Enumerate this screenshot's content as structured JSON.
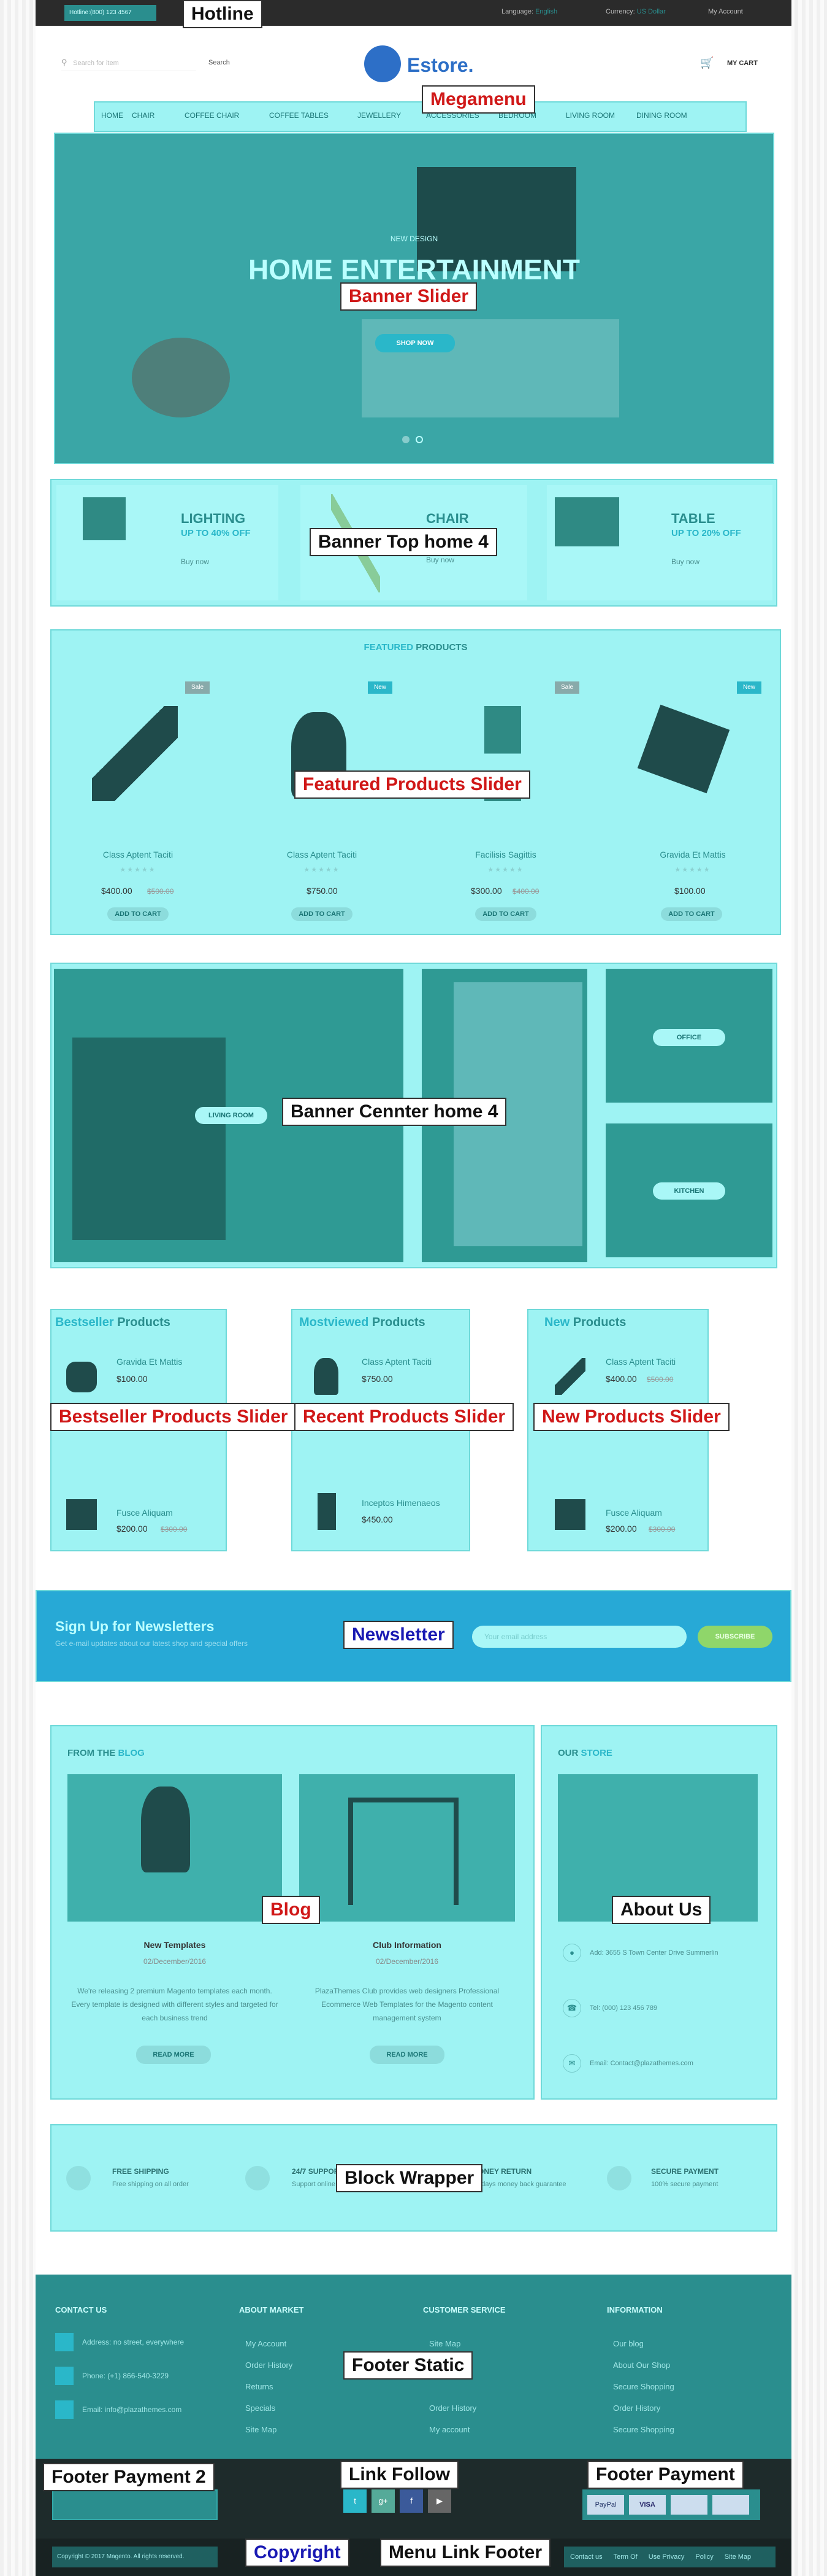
{
  "topbar": {
    "hotline": "Hotline:(800) 123 4567",
    "language_label": "Language:",
    "language": "English",
    "currency_label": "Currency:",
    "currency": "US Dollar",
    "account": "My Account"
  },
  "header": {
    "search_placeholder": "Search for item",
    "search_btn": "Search",
    "logo": "Estore.",
    "cart": "MY CART"
  },
  "menu": [
    "HOME",
    "CHAIR",
    "COFFEE CHAIR",
    "COFFEE TABLES",
    "JEWELLERY",
    "ACCESSORIES",
    "BEDROOM",
    "LIVING ROOM",
    "DINING ROOM"
  ],
  "banner": {
    "small": "NEW DESIGN",
    "title": "HOME ENTERTAINMENT",
    "btn": "SHOP NOW"
  },
  "promo": [
    {
      "title": "LIGHTING",
      "sub": "UP TO 40% OFF",
      "link": "Buy now"
    },
    {
      "title": "CHAIR",
      "sub": "",
      "link": "Buy now"
    },
    {
      "title": "TABLE",
      "sub": "UP TO 20% OFF",
      "link": "Buy now"
    }
  ],
  "featured": {
    "title_a": "FEATURED",
    "title_b": "PRODUCTS",
    "items": [
      {
        "badge": "Sale",
        "name": "Class Aptent Taciti",
        "price": "$400.00",
        "old": "$500.00"
      },
      {
        "badge": "New",
        "name": "Class Aptent Taciti",
        "price": "$750.00",
        "old": ""
      },
      {
        "badge": "Sale",
        "name": "Facilisis Sagittis",
        "price": "$300.00",
        "old": "$400.00"
      },
      {
        "badge": "New",
        "name": "Gravida Et Mattis",
        "price": "$100.00",
        "old": ""
      }
    ],
    "add": "ADD TO CART"
  },
  "center": {
    "living": "LIVING ROOM",
    "office": "OFFICE",
    "kitchen": "KITCHEN"
  },
  "lists": [
    {
      "a": "Bestseller",
      "b": "Products",
      "items": [
        {
          "name": "Gravida Et Mattis",
          "price": "$100.00",
          "old": ""
        },
        {
          "name": "Fusce Aliquam",
          "price": "$200.00",
          "old": "$300.00"
        }
      ]
    },
    {
      "a": "Mostviewed",
      "b": "Products",
      "items": [
        {
          "name": "Class Aptent Taciti",
          "price": "$750.00",
          "old": ""
        },
        {
          "name": "Inceptos Himenaeos",
          "price": "$450.00",
          "old": ""
        }
      ]
    },
    {
      "a": "New",
      "b": "Products",
      "items": [
        {
          "name": "Class Aptent Taciti",
          "price": "$400.00",
          "old": "$500.00"
        },
        {
          "name": "Fusce Aliquam",
          "price": "$200.00",
          "old": "$300.00"
        }
      ]
    }
  ],
  "newsletter": {
    "title": "Sign Up for Newsletters",
    "sub": "Get e-mail updates about our latest shop and special offers",
    "placeholder": "Your email address",
    "btn": "SUBSCRIBE"
  },
  "blog": {
    "title_a": "FROM THE",
    "title_b": "BLOG",
    "posts": [
      {
        "title": "New Templates",
        "date": "02/December/2016",
        "text": "We're releasing 2 premium Magento templates each month. Every template is designed with different styles and targeted for each business trend",
        "more": "READ MORE"
      },
      {
        "title": "Club Information",
        "date": "02/December/2016",
        "text": "PlazaThemes Club provides web designers Professional Ecommerce Web Templates for the Magento content management system",
        "more": "READ MORE"
      }
    ]
  },
  "store": {
    "title_a": "OUR",
    "title_b": "STORE",
    "address": "Add: 3655 S Town Center Drive Summerlin",
    "tel": "Tel: (000) 123 456 789",
    "email": "Email: Contact@plazathemes.com"
  },
  "services": [
    {
      "t": "FREE SHIPPING",
      "s": "Free shipping on all order"
    },
    {
      "t": "24/7 SUPPORT",
      "s": "Support online 24 hours"
    },
    {
      "t": "MONEY RETURN",
      "s": "30 days money back guarantee"
    },
    {
      "t": "SECURE PAYMENT",
      "s": "100% secure payment"
    }
  ],
  "footer": {
    "cols": [
      {
        "title": "CONTACT US",
        "lines": [
          "Address: no street, everywhere",
          "Phone: (+1) 866-540-3229",
          "Email: info@plazathemes.com"
        ]
      },
      {
        "title": "ABOUT MARKET",
        "lines": [
          "My Account",
          "Order History",
          "Returns",
          "Specials",
          "Site Map"
        ]
      },
      {
        "title": "CUSTOMER SERVICE",
        "lines": [
          "Site Map",
          "Order History",
          "My account"
        ]
      },
      {
        "title": "INFORMATION",
        "lines": [
          "Our blog",
          "About Our Shop",
          "Secure Shopping",
          "Order History",
          "Secure Shopping"
        ]
      }
    ],
    "copyright": "Copyright © 2017 Magento. All rights reserved.",
    "menu": [
      "Contact us",
      "Term Of",
      "Use Privacy",
      "Policy",
      "Site Map"
    ],
    "payments": [
      "PayPal",
      "VISA",
      "",
      ""
    ]
  },
  "callouts": {
    "hotline": "Hotline",
    "megamenu": "Megamenu",
    "banner": "Banner Slider",
    "top4": "Banner Top home 4",
    "featured": "Featured Products Slider",
    "center": "Banner Cennter home 4",
    "best": "Bestseller Products Slider",
    "recent": "Recent Products Slider",
    "new": "New Products Slider",
    "newsletter": "Newsletter",
    "blog": "Blog",
    "about": "About Us",
    "block": "Block Wrapper",
    "static": "Footer Static",
    "pay2": "Footer Payment 2",
    "follow": "Link Follow",
    "pay": "Footer Payment",
    "copy": "Copyright",
    "menulink": "Menu Link Footer"
  }
}
